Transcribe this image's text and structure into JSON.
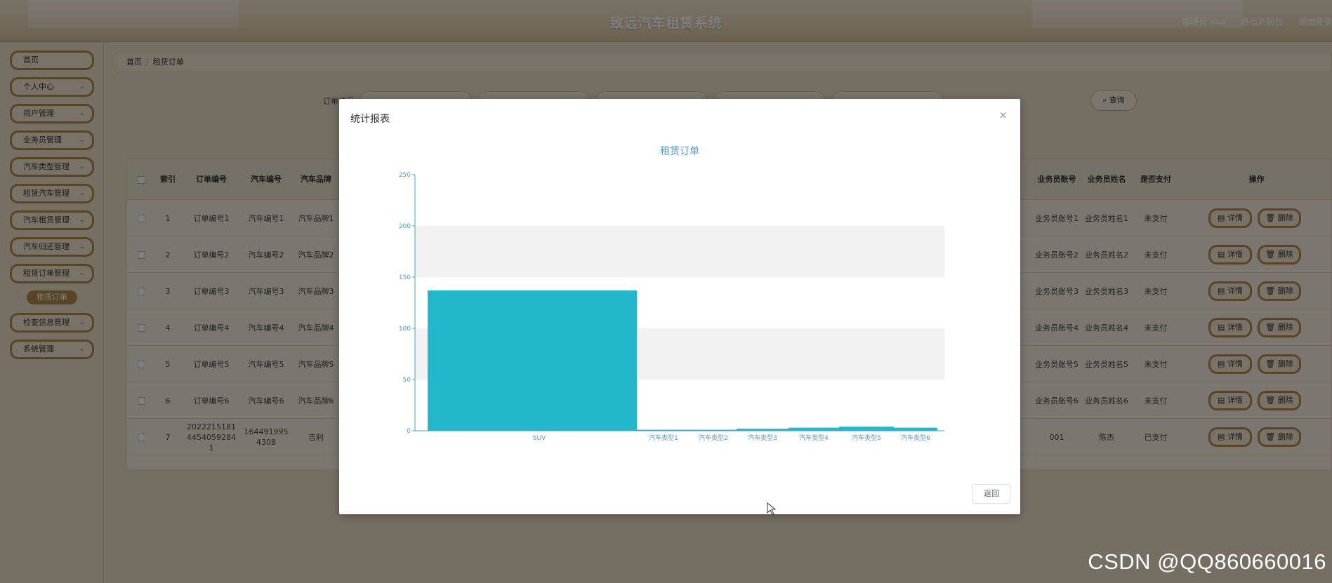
{
  "header": {
    "title": "致远汽车租赁系统",
    "admin_label": "管理员 abo",
    "back_front_label": "退出到前台",
    "logout_label": "退出登录"
  },
  "sidebar": {
    "items": [
      {
        "label": "首页"
      },
      {
        "label": "个人中心"
      },
      {
        "label": "用户管理"
      },
      {
        "label": "业务员管理"
      },
      {
        "label": "汽车类型管理"
      },
      {
        "label": "租赁汽车管理"
      },
      {
        "label": "汽车租赁管理"
      },
      {
        "label": "汽车归还管理"
      },
      {
        "label": "租赁订单管理"
      },
      {
        "label": "检查信息管理"
      },
      {
        "label": "系统管理"
      }
    ],
    "sub_item": "租赁订单"
  },
  "breadcrumb": {
    "home": "首页",
    "current": "租赁订单"
  },
  "filters": {
    "order_no_label": "订单编号",
    "search_label": "查询"
  },
  "table": {
    "headers": {
      "index": "索引",
      "order_no": "订单编号",
      "car_no": "汽车编号",
      "brand": "汽车品牌",
      "agent_acc": "业务员账号",
      "agent_name": "业务员姓名",
      "paid": "是否支付",
      "ops": "操作"
    },
    "detail_label": "详情",
    "delete_label": "删除",
    "rows": [
      {
        "idx": "1",
        "order": "订单编号1",
        "car": "汽车编号1",
        "brand": "汽车品牌1",
        "acc": "业务员账号1",
        "name": "业务员姓名1",
        "paid": "未支付"
      },
      {
        "idx": "2",
        "order": "订单编号2",
        "car": "汽车编号2",
        "brand": "汽车品牌2",
        "acc": "业务员账号2",
        "name": "业务员姓名2",
        "paid": "未支付"
      },
      {
        "idx": "3",
        "order": "订单编号3",
        "car": "汽车编号3",
        "brand": "汽车品牌3",
        "acc": "业务员账号3",
        "name": "业务员姓名3",
        "paid": "未支付"
      },
      {
        "idx": "4",
        "order": "订单编号4",
        "car": "汽车编号4",
        "brand": "汽车品牌4",
        "acc": "业务员账号4",
        "name": "业务员姓名4",
        "paid": "未支付"
      },
      {
        "idx": "5",
        "order": "订单编号5",
        "car": "汽车编号5",
        "brand": "汽车品牌5",
        "acc": "业务员账号5",
        "name": "业务员姓名5",
        "paid": "未支付"
      },
      {
        "idx": "6",
        "order": "订单编号6",
        "car": "汽车编号6",
        "brand": "汽车品牌6",
        "acc": "业务员账号6",
        "name": "业务员姓名6",
        "paid": "未支付"
      },
      {
        "idx": "7",
        "order": "202221518144540592841",
        "car": "1644919954308",
        "brand": "吉利",
        "acc": "001",
        "name": "陈杰",
        "paid": "已支付"
      }
    ]
  },
  "modal": {
    "title": "统计报表",
    "close": "×",
    "back_label": "返回"
  },
  "chart_data": {
    "type": "bar",
    "title": "租赁订单",
    "categories": [
      "SUV",
      "汽车类型1",
      "汽车类型2",
      "汽车类型3",
      "汽车类型4",
      "汽车类型5",
      "汽车类型6"
    ],
    "values": [
      137,
      1,
      1,
      2,
      3,
      4,
      3
    ],
    "ylim": [
      0,
      250
    ],
    "yticks": [
      0,
      50,
      100,
      150,
      200,
      250
    ],
    "bar_color": "#23b7cb",
    "axis_color": "#4a9fd0"
  },
  "watermark": "CSDN @QQ860660016"
}
